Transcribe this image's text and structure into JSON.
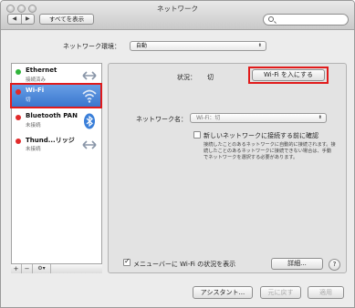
{
  "window": {
    "title": "ネットワーク"
  },
  "toolbar": {
    "back": "◀",
    "forward": "▶",
    "show_all": "すべてを表示",
    "search_placeholder": ""
  },
  "location": {
    "label": "ネットワーク環境：",
    "value": "自動"
  },
  "services": [
    {
      "name": "Ethernet",
      "status": "接続済み",
      "dot": "#2fb43a",
      "icon": "ethernet-arrows-icon"
    },
    {
      "name": "Wi-Fi",
      "status": "切",
      "dot": "#e12a2a",
      "icon": "wifi-icon"
    },
    {
      "name": "Bluetooth PAN",
      "status": "未接続",
      "dot": "#e12a2a",
      "icon": "bluetooth-icon"
    },
    {
      "name": "Thund...リッジ",
      "status": "未接続",
      "dot": "#e12a2a",
      "icon": "thunderbolt-arrows-icon"
    }
  ],
  "sidebar_bar": {
    "add": "+",
    "remove": "−",
    "gear": "⚙▾"
  },
  "detail": {
    "status_label": "状況：",
    "status_value": "切",
    "turn_on_button": "Wi-Fi を入にする",
    "network_name_label": "ネットワーク名：",
    "network_name_value": "Wi-Fi：切",
    "ask_join_label": "新しいネットワークに接続する前に確認",
    "ask_join_hint": "接続したことのあるネットワークに自動的に接続されます。接続したことのあるネットワークに接続できない場合は、手動でネットワークを選択する必要があります。",
    "show_menubar_label": "メニューバーに Wi-Fi の状況を表示",
    "advanced_button": "詳細...",
    "help": "?"
  },
  "footer": {
    "assist": "アシスタント...",
    "revert": "元に戻す",
    "apply": "適用"
  },
  "colors": {
    "highlight": "#e11b1b",
    "selection": "#3673cc"
  }
}
